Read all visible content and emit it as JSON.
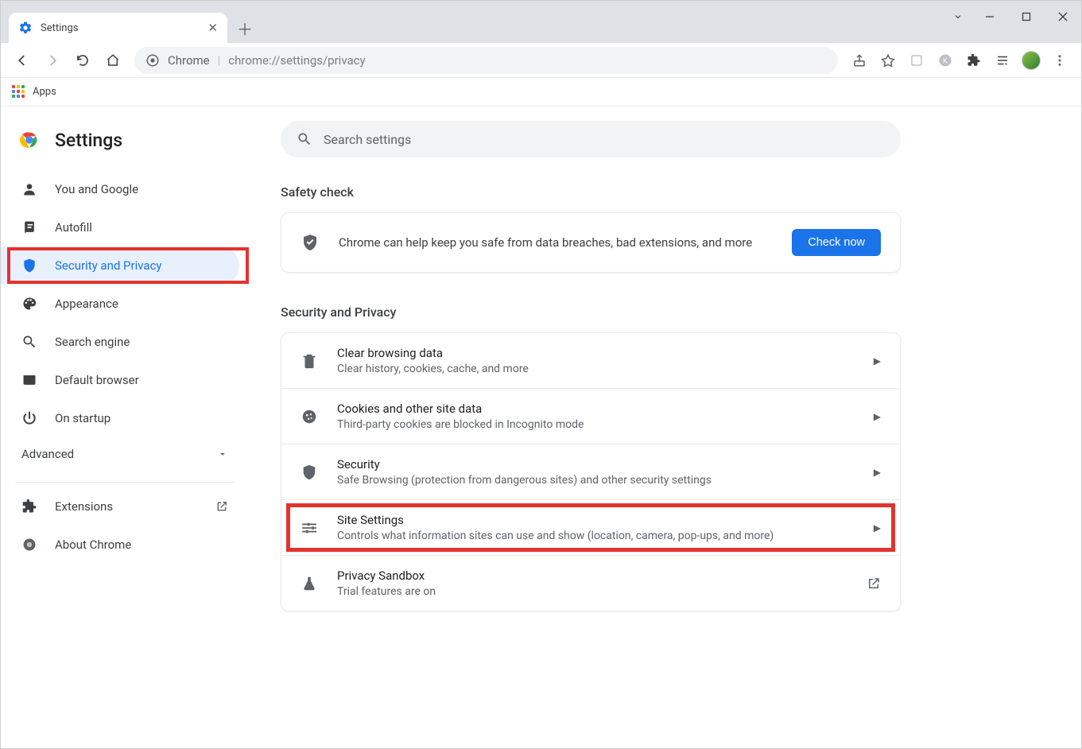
{
  "window": {
    "tab_title": "Settings",
    "url_scheme": "Chrome",
    "url_path": "chrome://settings/privacy"
  },
  "bookmarks": {
    "apps": "Apps"
  },
  "header": {
    "title": "Settings"
  },
  "search": {
    "placeholder": "Search settings"
  },
  "sidebar": {
    "items": [
      {
        "label": "You and Google"
      },
      {
        "label": "Autofill"
      },
      {
        "label": "Security and Privacy"
      },
      {
        "label": "Appearance"
      },
      {
        "label": "Search engine"
      },
      {
        "label": "Default browser"
      },
      {
        "label": "On startup"
      }
    ],
    "advanced": "Advanced",
    "extensions": "Extensions",
    "about": "About Chrome"
  },
  "safety": {
    "heading": "Safety check",
    "message": "Chrome can help keep you safe from data breaches, bad extensions, and more",
    "button": "Check now"
  },
  "privacy": {
    "heading": "Security and Privacy",
    "rows": [
      {
        "title": "Clear browsing data",
        "sub": "Clear history, cookies, cache, and more"
      },
      {
        "title": "Cookies and other site data",
        "sub": "Third-party cookies are blocked in Incognito mode"
      },
      {
        "title": "Security",
        "sub": "Safe Browsing (protection from dangerous sites) and other security settings"
      },
      {
        "title": "Site Settings",
        "sub": "Controls what information sites can use and show (location, camera, pop-ups, and more)"
      },
      {
        "title": "Privacy Sandbox",
        "sub": "Trial features are on"
      }
    ]
  }
}
